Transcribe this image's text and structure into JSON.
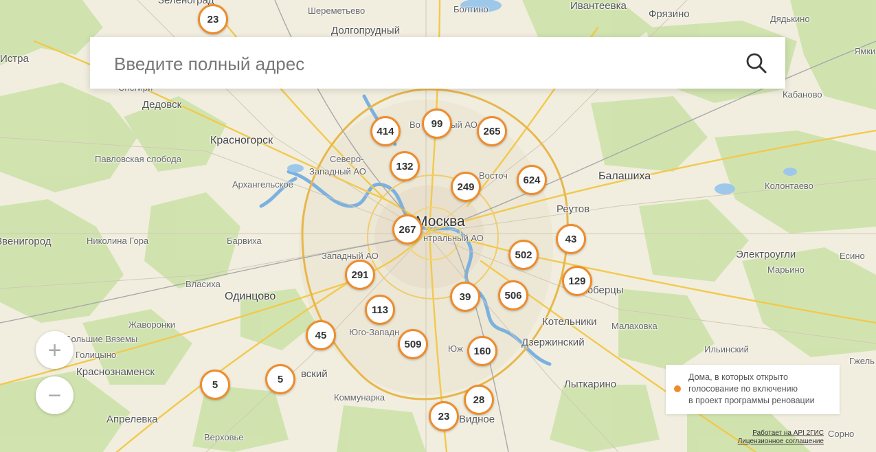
{
  "search": {
    "placeholder": "Введите полный адрес"
  },
  "zoom": {
    "in_label": "+",
    "out_label": "−"
  },
  "legend": {
    "line1": "Дома, в которых открыто",
    "line2": "голосование по включению",
    "line3": "в проект программы реновации",
    "marker_color": "#ee8c2c"
  },
  "attribution": {
    "api": "Работает на API 2ГИС",
    "license": "Лицензионное соглашение"
  },
  "clusters": [
    "23",
    "414",
    "99",
    "265",
    "132",
    "249",
    "624",
    "267",
    "43",
    "502",
    "291",
    "129",
    "39",
    "506",
    "113",
    "45",
    "509",
    "160",
    "5",
    "5",
    "28",
    "23"
  ],
  "places": {
    "zelenograd": "Зеленоград",
    "sheremetyevo": "Шереметьево",
    "boltino": "Болтино",
    "ivanteevka": "Ивантеевка",
    "fryazino": "Фрязино",
    "dolgoprudny": "Долгопрудный",
    "dyadkino": "Дядькино",
    "istra": "Истра",
    "yamkino": "Ямки",
    "snegiri": "Снегири",
    "kabanovo": "Кабаново",
    "dedovsk": "Дедовск",
    "krasnogorsk": "Красногорск",
    "pavlovskaya": "Павловская слобода",
    "severo_zap1": "Северо-",
    "severo_zap2": "Западный АО",
    "vost_ao_n": "Во",
    "vost_ao_n2": "ный АО",
    "vostochny": "Восточ",
    "balashikha": "Балашиха",
    "kolontaevo": "Колонтаево",
    "arkhangelskoe": "Архангельское",
    "reutov": "Реутов",
    "moskva": "Москва",
    "centr_ao": "нтральный АО",
    "zvenigorod": "Звенигород",
    "nikolina": "Николина Гора",
    "barvikha": "Барвиха",
    "zapadny_ao": "Западный АО",
    "elektrougli": "Электроугли",
    "esino": "Есино",
    "maryino": "Марьино",
    "vlasikha": "Власиха",
    "odintsovo": "Одинцово",
    "lyubertsy": "Люберцы",
    "zhavoronki": "Жаворонки",
    "kotelniki": "Котельники",
    "malakhovka": "Малаховка",
    "bolshie_vyazemy": "Большие Вяземы",
    "yugo_zap": "Юго-Западн",
    "dzerzhinsky": "Дзержинский",
    "golitsyno": "Голицыно",
    "yuzh": "Юж",
    "ilyinsky": "Ильинский",
    "gzhel": "Гжель",
    "krasnoznamensk": "Краснознаменск",
    "vnukovsky": "вский",
    "lytkarino": "Лыткарино",
    "kommunarka": "Коммунарка",
    "aprelevka": "Апрелевка",
    "vidnoe": "Видное",
    "verkhovye": "Верховье",
    "kalinovo": "Сорно"
  }
}
